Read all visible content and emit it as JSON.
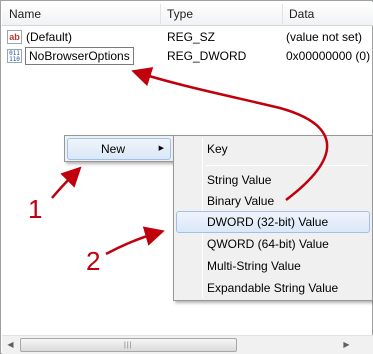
{
  "columns": [
    "Name",
    "Type",
    "Data"
  ],
  "rows": [
    {
      "icon": "string-value-icon",
      "icon_text": "ab",
      "name": "(Default)",
      "type": "REG_SZ",
      "data": "(value not set)"
    },
    {
      "icon": "binary-value-icon",
      "icon_text": "011\n110",
      "name": "NoBrowserOptions",
      "type": "REG_DWORD",
      "data": "0x00000000 (0)"
    }
  ],
  "context_menu": {
    "new_label": "New",
    "submenu": [
      "Key",
      "String Value",
      "Binary Value",
      "DWORD (32-bit) Value",
      "QWORD (64-bit) Value",
      "Multi-String Value",
      "Expandable String Value"
    ],
    "highlighted": "DWORD (32-bit) Value"
  },
  "annotations": {
    "step1": "1",
    "step2": "2"
  },
  "colors": {
    "annotation": "#c0000c",
    "highlight_border": "#9fc1e9",
    "menu_bg": "#f0f0f0"
  }
}
